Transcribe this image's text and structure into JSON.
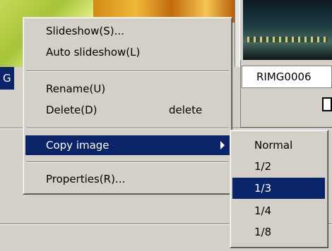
{
  "background": {
    "left_label": "G",
    "filename": "RIMG0006"
  },
  "context_menu": {
    "items": [
      {
        "label": "Slideshow(S)..."
      },
      {
        "label": "Auto slideshow(L)"
      },
      {
        "label": "Rename(U)"
      },
      {
        "label": "Delete(D)",
        "accelerator": "delete"
      },
      {
        "label": "Copy image",
        "has_submenu": true,
        "highlighted": true
      },
      {
        "label": "Properties(R)..."
      }
    ]
  },
  "submenu": {
    "items": [
      {
        "label": "Normal"
      },
      {
        "label": "1/2"
      },
      {
        "label": "1/3",
        "highlighted": true
      },
      {
        "label": "1/4"
      },
      {
        "label": "1/8"
      }
    ]
  },
  "colors": {
    "menu_face": "#d4d0c8",
    "selection": "#0a246a",
    "selection_text": "#ffffff"
  }
}
